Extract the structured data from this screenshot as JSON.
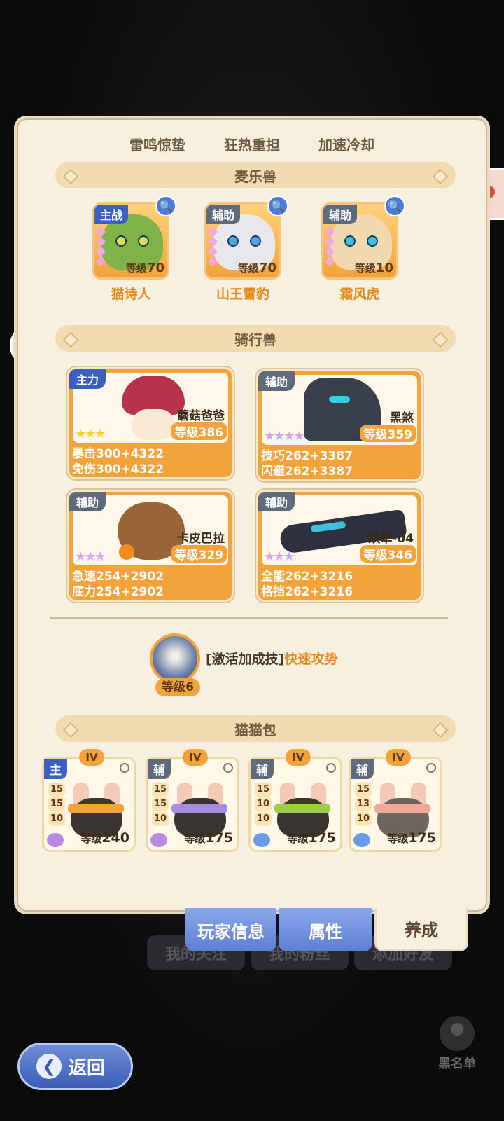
{
  "background": {
    "buttons": [
      "我的关注",
      "我的粉丝",
      "添加好友"
    ],
    "blacklist_label": "黑名单"
  },
  "back_button": {
    "label": "返回"
  },
  "panel": {
    "tabs": [
      "雷鸣惊蛰",
      "狂热重担",
      "加速冷却"
    ],
    "music_section_title": "麦乐兽",
    "music_beasts": [
      {
        "role": "主战",
        "level_label": "等级",
        "level": "70",
        "name": "猫诗人"
      },
      {
        "role": "辅助",
        "level_label": "等级",
        "level": "70",
        "name": "山王雪豹"
      },
      {
        "role": "辅助",
        "level_label": "等级",
        "level": "10",
        "name": "霜风虎"
      }
    ],
    "mount_section_title": "骑行兽",
    "mounts": [
      {
        "role": "主力",
        "name": "蘑菇爸爸",
        "level": "等级386",
        "stars": "★★★",
        "star_color": "#f7d23a",
        "stats": [
          "暴击300+4322",
          "免伤300+4322"
        ]
      },
      {
        "role": "辅助",
        "name": "黑煞",
        "level": "等级359",
        "stars": "★★★★",
        "star_color": "#d8a3f2",
        "stats": [
          "技巧262+3387",
          "闪避262+3387"
        ]
      },
      {
        "role": "辅助",
        "name": "卡皮巴拉",
        "level": "等级329",
        "stars": "★★★",
        "star_color": "#d8a3f2",
        "stats": [
          "急速254+2902",
          "底力254+2902"
        ]
      },
      {
        "role": "辅助",
        "name": "跃隼-04",
        "level": "等级346",
        "stars": "★★★",
        "star_color": "#d8a3f2",
        "stats": [
          "全能262+3216",
          "格挡262+3216"
        ]
      }
    ],
    "skill": {
      "level": "等级6",
      "prefix": "[激活加成技]",
      "name": "快速攻势"
    },
    "cat_section_title": "猫猫包",
    "cat_bags": [
      {
        "tier": "IV",
        "role": "主",
        "nums": [
          "15",
          "15",
          "10"
        ],
        "level_label": "等级",
        "level": "240",
        "band_color": "#f2a33b",
        "paw_color": "#b98ae0"
      },
      {
        "tier": "IV",
        "role": "辅",
        "nums": [
          "15",
          "15",
          "10"
        ],
        "level_label": "等级",
        "level": "175",
        "band_color": "#a78be0",
        "paw_color": "#b98ae0"
      },
      {
        "tier": "IV",
        "role": "辅",
        "nums": [
          "15",
          "10",
          "10"
        ],
        "level_label": "等级",
        "level": "175",
        "band_color": "#9ccc4a",
        "paw_color": "#6a9be8"
      },
      {
        "tier": "IV",
        "role": "辅",
        "nums": [
          "15",
          "13",
          "10"
        ],
        "level_label": "等级",
        "level": "175",
        "band_color": "#f0a898",
        "paw_color": "#6a9be8"
      }
    ]
  },
  "bottom_tabs": [
    "玩家信息",
    "属性",
    "养成"
  ]
}
